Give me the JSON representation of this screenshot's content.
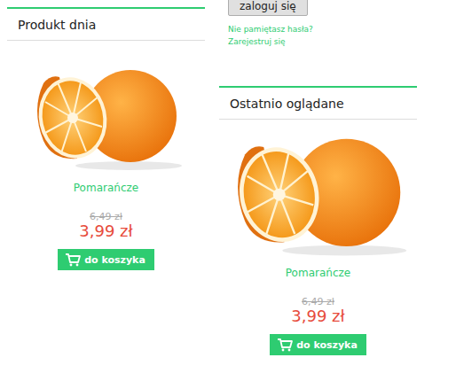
{
  "login": {
    "button": "zaloguj się",
    "links": [
      "Nie pamiętasz hasła?",
      "Zarejestruj się"
    ]
  },
  "panels": [
    {
      "title": "Produkt dnia",
      "product": {
        "name": "Pomarańcze",
        "old_price": "6,49 zł",
        "price": "3,99 zł",
        "button": "do koszyka"
      }
    },
    {
      "title": "Ostatnio oglądane",
      "product": {
        "name": "Pomarańcze",
        "old_price": "6,49 zł",
        "price": "3,99 zł",
        "button": "do koszyka"
      }
    }
  ]
}
